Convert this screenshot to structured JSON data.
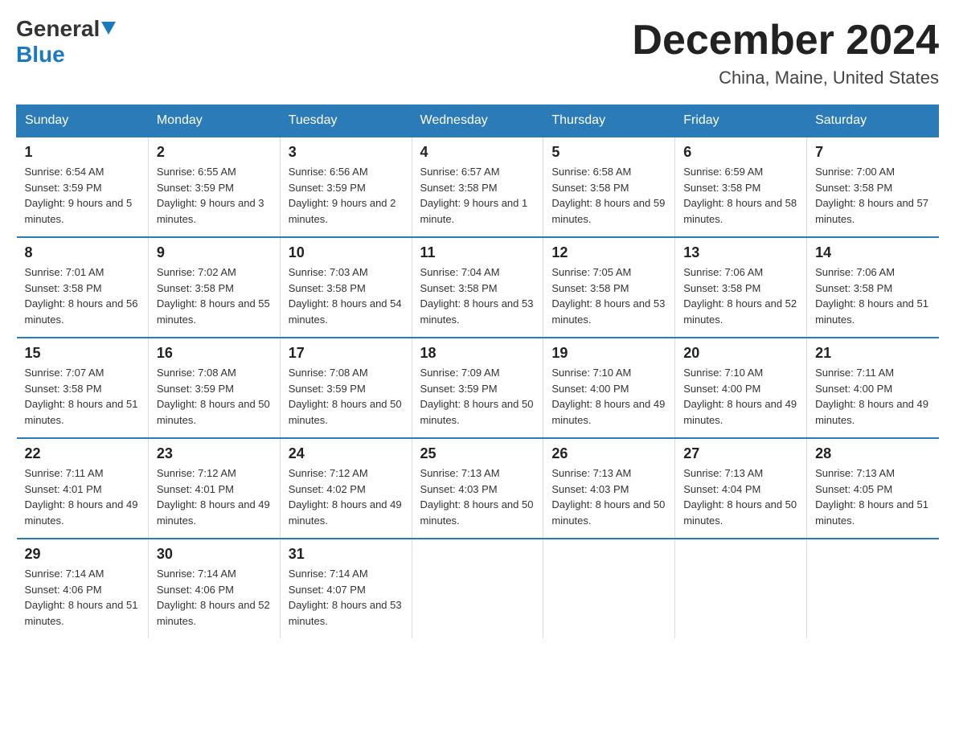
{
  "logo": {
    "general": "General",
    "blue": "Blue",
    "triangle": "▲"
  },
  "title": "December 2024",
  "subtitle": "China, Maine, United States",
  "days_of_week": [
    "Sunday",
    "Monday",
    "Tuesday",
    "Wednesday",
    "Thursday",
    "Friday",
    "Saturday"
  ],
  "weeks": [
    [
      {
        "day": "1",
        "sunrise": "6:54 AM",
        "sunset": "3:59 PM",
        "daylight": "9 hours and 5 minutes."
      },
      {
        "day": "2",
        "sunrise": "6:55 AM",
        "sunset": "3:59 PM",
        "daylight": "9 hours and 3 minutes."
      },
      {
        "day": "3",
        "sunrise": "6:56 AM",
        "sunset": "3:59 PM",
        "daylight": "9 hours and 2 minutes."
      },
      {
        "day": "4",
        "sunrise": "6:57 AM",
        "sunset": "3:58 PM",
        "daylight": "9 hours and 1 minute."
      },
      {
        "day": "5",
        "sunrise": "6:58 AM",
        "sunset": "3:58 PM",
        "daylight": "8 hours and 59 minutes."
      },
      {
        "day": "6",
        "sunrise": "6:59 AM",
        "sunset": "3:58 PM",
        "daylight": "8 hours and 58 minutes."
      },
      {
        "day": "7",
        "sunrise": "7:00 AM",
        "sunset": "3:58 PM",
        "daylight": "8 hours and 57 minutes."
      }
    ],
    [
      {
        "day": "8",
        "sunrise": "7:01 AM",
        "sunset": "3:58 PM",
        "daylight": "8 hours and 56 minutes."
      },
      {
        "day": "9",
        "sunrise": "7:02 AM",
        "sunset": "3:58 PM",
        "daylight": "8 hours and 55 minutes."
      },
      {
        "day": "10",
        "sunrise": "7:03 AM",
        "sunset": "3:58 PM",
        "daylight": "8 hours and 54 minutes."
      },
      {
        "day": "11",
        "sunrise": "7:04 AM",
        "sunset": "3:58 PM",
        "daylight": "8 hours and 53 minutes."
      },
      {
        "day": "12",
        "sunrise": "7:05 AM",
        "sunset": "3:58 PM",
        "daylight": "8 hours and 53 minutes."
      },
      {
        "day": "13",
        "sunrise": "7:06 AM",
        "sunset": "3:58 PM",
        "daylight": "8 hours and 52 minutes."
      },
      {
        "day": "14",
        "sunrise": "7:06 AM",
        "sunset": "3:58 PM",
        "daylight": "8 hours and 51 minutes."
      }
    ],
    [
      {
        "day": "15",
        "sunrise": "7:07 AM",
        "sunset": "3:58 PM",
        "daylight": "8 hours and 51 minutes."
      },
      {
        "day": "16",
        "sunrise": "7:08 AM",
        "sunset": "3:59 PM",
        "daylight": "8 hours and 50 minutes."
      },
      {
        "day": "17",
        "sunrise": "7:08 AM",
        "sunset": "3:59 PM",
        "daylight": "8 hours and 50 minutes."
      },
      {
        "day": "18",
        "sunrise": "7:09 AM",
        "sunset": "3:59 PM",
        "daylight": "8 hours and 50 minutes."
      },
      {
        "day": "19",
        "sunrise": "7:10 AM",
        "sunset": "4:00 PM",
        "daylight": "8 hours and 49 minutes."
      },
      {
        "day": "20",
        "sunrise": "7:10 AM",
        "sunset": "4:00 PM",
        "daylight": "8 hours and 49 minutes."
      },
      {
        "day": "21",
        "sunrise": "7:11 AM",
        "sunset": "4:00 PM",
        "daylight": "8 hours and 49 minutes."
      }
    ],
    [
      {
        "day": "22",
        "sunrise": "7:11 AM",
        "sunset": "4:01 PM",
        "daylight": "8 hours and 49 minutes."
      },
      {
        "day": "23",
        "sunrise": "7:12 AM",
        "sunset": "4:01 PM",
        "daylight": "8 hours and 49 minutes."
      },
      {
        "day": "24",
        "sunrise": "7:12 AM",
        "sunset": "4:02 PM",
        "daylight": "8 hours and 49 minutes."
      },
      {
        "day": "25",
        "sunrise": "7:13 AM",
        "sunset": "4:03 PM",
        "daylight": "8 hours and 50 minutes."
      },
      {
        "day": "26",
        "sunrise": "7:13 AM",
        "sunset": "4:03 PM",
        "daylight": "8 hours and 50 minutes."
      },
      {
        "day": "27",
        "sunrise": "7:13 AM",
        "sunset": "4:04 PM",
        "daylight": "8 hours and 50 minutes."
      },
      {
        "day": "28",
        "sunrise": "7:13 AM",
        "sunset": "4:05 PM",
        "daylight": "8 hours and 51 minutes."
      }
    ],
    [
      {
        "day": "29",
        "sunrise": "7:14 AM",
        "sunset": "4:06 PM",
        "daylight": "8 hours and 51 minutes."
      },
      {
        "day": "30",
        "sunrise": "7:14 AM",
        "sunset": "4:06 PM",
        "daylight": "8 hours and 52 minutes."
      },
      {
        "day": "31",
        "sunrise": "7:14 AM",
        "sunset": "4:07 PM",
        "daylight": "8 hours and 53 minutes."
      },
      null,
      null,
      null,
      null
    ]
  ]
}
